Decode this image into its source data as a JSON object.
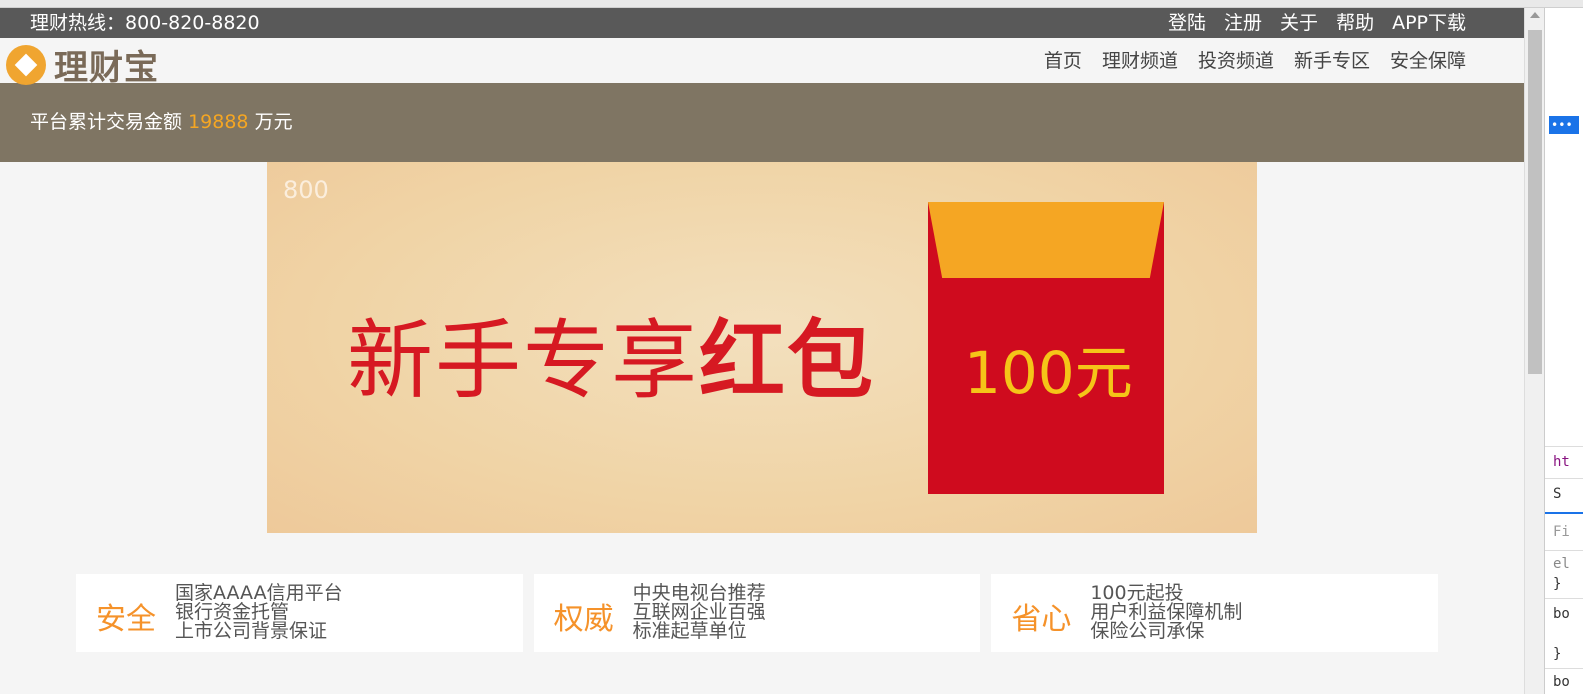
{
  "topbar": {
    "hotline": "理财热线：800-820-8820",
    "links": [
      "登陆",
      "注册",
      "关于",
      "帮助",
      "APP下载"
    ]
  },
  "header": {
    "logo_text": "理财宝",
    "nav": [
      "首页",
      "理财频道",
      "投资频道",
      "新手专区",
      "安全保障"
    ]
  },
  "stats": {
    "prefix": "平台累计交易金额",
    "amount": "19888",
    "unit": "万元"
  },
  "banner": {
    "corner_number": "800",
    "slogan_light": "新手专享",
    "slogan_bold": "红包",
    "envelope_amount": "100元"
  },
  "features": [
    {
      "title": "安全",
      "lines": [
        "国家AAAA信用平台",
        "银行资金托管",
        "上市公司背景保证"
      ]
    },
    {
      "title": "权威",
      "lines": [
        "中央电视台推荐",
        "互联网企业百强",
        "标准起草单位"
      ]
    },
    {
      "title": "省心",
      "lines": [
        "100元起投",
        "用户利益保障机制",
        "保险公司承保"
      ]
    }
  ],
  "devtools": {
    "ellipsis": "•••",
    "html_tag": "ht",
    "styles_tab": "S",
    "filter": "Fi",
    "code": [
      "el",
      "}",
      "bo",
      "}",
      "bo"
    ]
  },
  "colors": {
    "topbar_bg": "#595959",
    "stats_bg": "#7f7563",
    "accent_orange": "#f5a623",
    "banner_red": "#d61922",
    "envelope_red": "#cf0b1e",
    "feature_orange": "#f5922a"
  }
}
